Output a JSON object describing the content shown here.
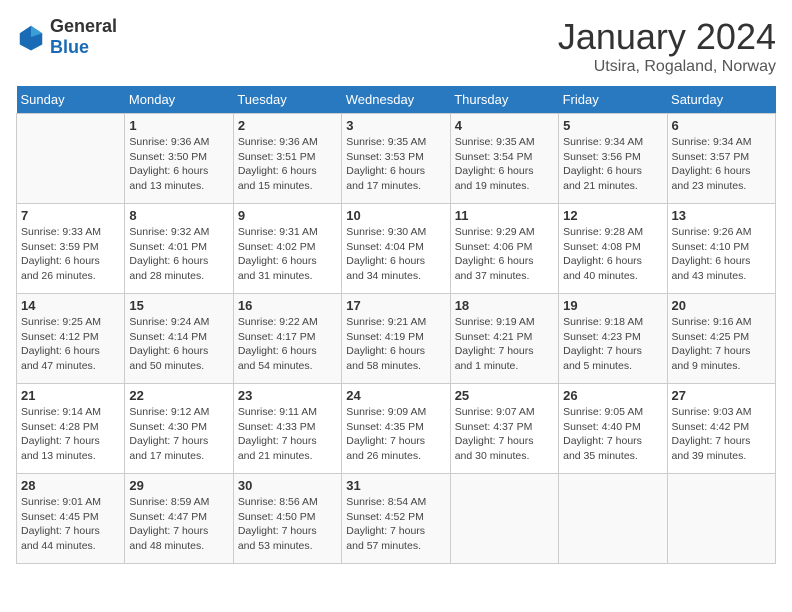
{
  "header": {
    "logo_general": "General",
    "logo_blue": "Blue",
    "month": "January 2024",
    "location": "Utsira, Rogaland, Norway"
  },
  "days_of_week": [
    "Sunday",
    "Monday",
    "Tuesday",
    "Wednesday",
    "Thursday",
    "Friday",
    "Saturday"
  ],
  "weeks": [
    [
      {
        "day": "",
        "info": ""
      },
      {
        "day": "1",
        "info": "Sunrise: 9:36 AM\nSunset: 3:50 PM\nDaylight: 6 hours\nand 13 minutes."
      },
      {
        "day": "2",
        "info": "Sunrise: 9:36 AM\nSunset: 3:51 PM\nDaylight: 6 hours\nand 15 minutes."
      },
      {
        "day": "3",
        "info": "Sunrise: 9:35 AM\nSunset: 3:53 PM\nDaylight: 6 hours\nand 17 minutes."
      },
      {
        "day": "4",
        "info": "Sunrise: 9:35 AM\nSunset: 3:54 PM\nDaylight: 6 hours\nand 19 minutes."
      },
      {
        "day": "5",
        "info": "Sunrise: 9:34 AM\nSunset: 3:56 PM\nDaylight: 6 hours\nand 21 minutes."
      },
      {
        "day": "6",
        "info": "Sunrise: 9:34 AM\nSunset: 3:57 PM\nDaylight: 6 hours\nand 23 minutes."
      }
    ],
    [
      {
        "day": "7",
        "info": "Sunrise: 9:33 AM\nSunset: 3:59 PM\nDaylight: 6 hours\nand 26 minutes."
      },
      {
        "day": "8",
        "info": "Sunrise: 9:32 AM\nSunset: 4:01 PM\nDaylight: 6 hours\nand 28 minutes."
      },
      {
        "day": "9",
        "info": "Sunrise: 9:31 AM\nSunset: 4:02 PM\nDaylight: 6 hours\nand 31 minutes."
      },
      {
        "day": "10",
        "info": "Sunrise: 9:30 AM\nSunset: 4:04 PM\nDaylight: 6 hours\nand 34 minutes."
      },
      {
        "day": "11",
        "info": "Sunrise: 9:29 AM\nSunset: 4:06 PM\nDaylight: 6 hours\nand 37 minutes."
      },
      {
        "day": "12",
        "info": "Sunrise: 9:28 AM\nSunset: 4:08 PM\nDaylight: 6 hours\nand 40 minutes."
      },
      {
        "day": "13",
        "info": "Sunrise: 9:26 AM\nSunset: 4:10 PM\nDaylight: 6 hours\nand 43 minutes."
      }
    ],
    [
      {
        "day": "14",
        "info": "Sunrise: 9:25 AM\nSunset: 4:12 PM\nDaylight: 6 hours\nand 47 minutes."
      },
      {
        "day": "15",
        "info": "Sunrise: 9:24 AM\nSunset: 4:14 PM\nDaylight: 6 hours\nand 50 minutes."
      },
      {
        "day": "16",
        "info": "Sunrise: 9:22 AM\nSunset: 4:17 PM\nDaylight: 6 hours\nand 54 minutes."
      },
      {
        "day": "17",
        "info": "Sunrise: 9:21 AM\nSunset: 4:19 PM\nDaylight: 6 hours\nand 58 minutes."
      },
      {
        "day": "18",
        "info": "Sunrise: 9:19 AM\nSunset: 4:21 PM\nDaylight: 7 hours\nand 1 minute."
      },
      {
        "day": "19",
        "info": "Sunrise: 9:18 AM\nSunset: 4:23 PM\nDaylight: 7 hours\nand 5 minutes."
      },
      {
        "day": "20",
        "info": "Sunrise: 9:16 AM\nSunset: 4:25 PM\nDaylight: 7 hours\nand 9 minutes."
      }
    ],
    [
      {
        "day": "21",
        "info": "Sunrise: 9:14 AM\nSunset: 4:28 PM\nDaylight: 7 hours\nand 13 minutes."
      },
      {
        "day": "22",
        "info": "Sunrise: 9:12 AM\nSunset: 4:30 PM\nDaylight: 7 hours\nand 17 minutes."
      },
      {
        "day": "23",
        "info": "Sunrise: 9:11 AM\nSunset: 4:33 PM\nDaylight: 7 hours\nand 21 minutes."
      },
      {
        "day": "24",
        "info": "Sunrise: 9:09 AM\nSunset: 4:35 PM\nDaylight: 7 hours\nand 26 minutes."
      },
      {
        "day": "25",
        "info": "Sunrise: 9:07 AM\nSunset: 4:37 PM\nDaylight: 7 hours\nand 30 minutes."
      },
      {
        "day": "26",
        "info": "Sunrise: 9:05 AM\nSunset: 4:40 PM\nDaylight: 7 hours\nand 35 minutes."
      },
      {
        "day": "27",
        "info": "Sunrise: 9:03 AM\nSunset: 4:42 PM\nDaylight: 7 hours\nand 39 minutes."
      }
    ],
    [
      {
        "day": "28",
        "info": "Sunrise: 9:01 AM\nSunset: 4:45 PM\nDaylight: 7 hours\nand 44 minutes."
      },
      {
        "day": "29",
        "info": "Sunrise: 8:59 AM\nSunset: 4:47 PM\nDaylight: 7 hours\nand 48 minutes."
      },
      {
        "day": "30",
        "info": "Sunrise: 8:56 AM\nSunset: 4:50 PM\nDaylight: 7 hours\nand 53 minutes."
      },
      {
        "day": "31",
        "info": "Sunrise: 8:54 AM\nSunset: 4:52 PM\nDaylight: 7 hours\nand 57 minutes."
      },
      {
        "day": "",
        "info": ""
      },
      {
        "day": "",
        "info": ""
      },
      {
        "day": "",
        "info": ""
      }
    ]
  ]
}
